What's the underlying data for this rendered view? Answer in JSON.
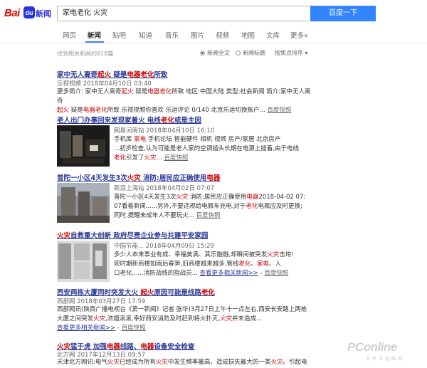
{
  "logo": {
    "part1": "Bai",
    "part2": "du",
    "part3": "新闻"
  },
  "search": {
    "query": "家电老化 火灾",
    "button": "百度一下"
  },
  "tabs": [
    "网页",
    "新闻",
    "贴吧",
    "知道",
    "音乐",
    "图片",
    "视频",
    "地图",
    "文库",
    "更多»"
  ],
  "active_tab": "新闻",
  "result_count": "找到相关新闻约818篇",
  "filters": {
    "full_text": "新闻全文",
    "title": "新闻标题",
    "sort": "按焦点排序"
  },
  "results": [
    {
      "title_parts": [
        "家中无人离奇",
        "起火",
        " 疑是",
        "电器老化",
        "所致"
      ],
      "meta": "乐视视频  2018年04月10日 03:40",
      "snippet1_parts": [
        "更多简介: 家中无人离奇",
        "起火",
        " 疑是",
        "电器老化",
        "所致 地区:中国大陆 类型:社会新闻 简介:家中无人离奇"
      ],
      "snippet2_parts": [
        "起火",
        " 疑是",
        "电器老化",
        "所致 乐视视频你喜欢 乐运评论 0/140 北京乐运切换账户..."
      ],
      "snapshot": "百度快照"
    },
    {
      "title_parts": [
        "老人出门办事回来发现家着火 电线",
        "老化",
        "或是主因"
      ],
      "meta": "网易河南站  2018年04月10日 16:10",
      "snippet1_parts": [
        "手机库 ",
        "家电",
        " 手机论坛 智能硬件 相机 视频 房产/家居 北京房产"
      ],
      "snippet2_parts": [
        "...初步检查,认为可能是老人家的空调插头长期在电源上插着,由于电线"
      ],
      "snippet3_parts": [
        "老化",
        "引发了",
        "火灾",
        "..."
      ],
      "snapshot": "百度快照"
    },
    {
      "title_parts": [
        "普陀一小区4天发生3次",
        "火灾",
        " 消防:居民应正确使用",
        "电器"
      ],
      "meta": "新浪上海站  2018年04月02日 07:07",
      "snippet1_parts": [
        "普陀一小区4天发生3次",
        "火灾",
        " 消防:居民应正确使用",
        "电器",
        "2018-04-02 07:"
      ],
      "snippet2_parts": [
        "07看着新闻......另外,不要违规给电瓶车充电,对于",
        "老化",
        "电瓶应及时更换;"
      ],
      "snippet3_parts": [
        "同时,提醒未成年人不要玩火..."
      ],
      "snapshot": "百度快照"
    },
    {
      "title_parts": [
        "火灾",
        "自救重大创新 政府尽责企业参与共建平安家园"
      ],
      "meta": "中国节能...  2018年04月09日 15:29",
      "snippet1_parts": [
        "多少人本来事业有成、幸福美满、其乐融融,却瞬间被突发",
        "火灾",
        "击垮!"
      ],
      "snippet2_parts": [
        "现时期新商楼如雨后春笋,旧商楼越来越多,管线",
        "老化",
        "、",
        "家电",
        "、人"
      ],
      "snippet3_parts": [
        "口老化......消防战线的指战员..."
      ],
      "more": "查看更多相关新闻>>",
      "snapshot": "百度快照"
    },
    {
      "title_parts": [
        "西安两栋大厦同时突发大火 ",
        "起火",
        "原因可能是线路",
        "老化"
      ],
      "meta": "西部网  2018年03月27日 17:59",
      "snippet1_parts": [
        "西部网讯(陕西广播电视台《第一新闻》记者 张华)3月27日上午十一点左右,西安长安路上两栋"
      ],
      "snippet2_parts": [
        "大厦之间突发",
        "火灾",
        ",浓烟滚滚,幸好西安消防及时赶到将火扑灭,",
        "火灾",
        "并未造成..."
      ],
      "more": "查看更多相关新闻>>",
      "snapshot": "百度快照"
    },
    {
      "title_parts": [
        "火灾",
        "猛于虎 加强",
        "电器",
        "线路、",
        "电器",
        "设备安全检查"
      ],
      "meta": "北方网  2017年12月13日 09:57",
      "snippet1_parts": [
        "天津北方网讯:电气",
        "火灾",
        "已经成为所有",
        "火灾",
        "中发生频率最高、造成损失最大的一类",
        "火灾",
        "。引起电"
      ]
    }
  ],
  "watermark": {
    "brand": "PConline",
    "sub": "太平洋电脑网"
  }
}
